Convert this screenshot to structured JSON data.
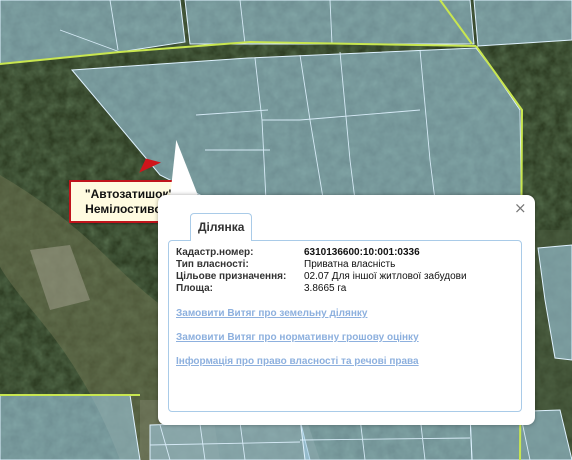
{
  "map": {
    "parcel_fill": "#9ecae1",
    "parcel_stroke": "#dff2ff",
    "boundary_color": "#c8e650"
  },
  "callout": {
    "line1": "\"Автозатишок\"",
    "line2": "Немілостивого",
    "border_color": "#c0141b"
  },
  "popup": {
    "close_symbol": "×",
    "tab_label": "Ділянка",
    "attributes": [
      {
        "label": "Кадастр.номер:",
        "value": "6310136600:10:001:0336"
      },
      {
        "label": "Тип власності:",
        "value": "Приватна власність"
      },
      {
        "label": "Цільове призначення:",
        "value": "02.07 Для іншої житлової забудови"
      },
      {
        "label": "Площа:",
        "value": "3.8665 га"
      }
    ],
    "links": [
      "Замовити Витяг про земельну ділянку",
      "Замовити Витяг про нормативну грошову оцінку",
      "Інформація про право власності та речові права"
    ]
  }
}
